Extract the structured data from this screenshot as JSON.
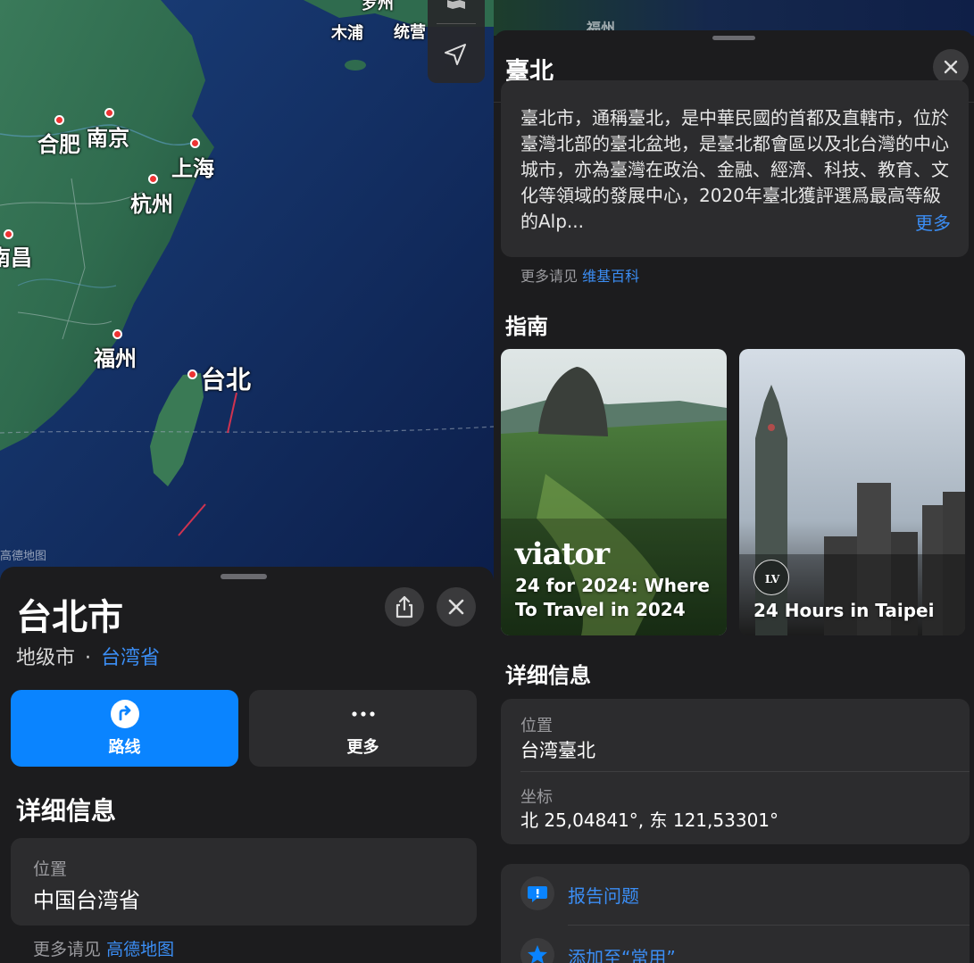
{
  "map": {
    "labels": {
      "hefei": "合肥",
      "nanjing": "南京",
      "shanghai": "上海",
      "hangzhou": "杭州",
      "nanchang": "南昌",
      "fuzhou": "福州",
      "taipei": "台北",
      "mupo": "木浦",
      "tongyeong": "统营",
      "top_partial": "罗州"
    },
    "attribution": "高德地图",
    "right_strip_label": "福州"
  },
  "left_sheet": {
    "title": "台北市",
    "subtitle_type": "地级市",
    "subtitle_sep": "·",
    "subtitle_link": "台湾省",
    "route_label": "路线",
    "more_label": "更多",
    "details_heading": "详细信息",
    "location_label": "位置",
    "location_value": "中国台湾省",
    "more_source_prefix": "更多请见",
    "more_source_link": "高德地图"
  },
  "right_sheet": {
    "title": "臺北",
    "description": "臺北市，通稱臺北，是中華民國的首都及直轄市，位於臺灣北部的臺北盆地，是臺北都會區以及北台灣的中心城市，亦為臺灣在政治、金融、經濟、科技、教育、文化等領域的發展中心，2020年臺北獲評選爲最高等級的Alp...",
    "description_more": "更多",
    "wiki_prefix": "更多请见",
    "wiki_link": "维基百科",
    "guides_heading": "指南",
    "guides": [
      {
        "brand": "viator",
        "caption_line1": "24 for 2024: Where",
        "caption_line2": "To Travel in 2024"
      },
      {
        "brand": "LOUIS VUITTON CITY GUIDE",
        "caption_line1": "24 Hours in Taipei"
      }
    ],
    "details_heading": "详细信息",
    "location_label": "位置",
    "location_value": "台湾臺北",
    "coords_label": "坐标",
    "coords_value": "北 25,04841°, 东 121,53301°",
    "report_label": "报告问题",
    "favorite_label": "添加至“常用”"
  },
  "colors": {
    "accent_blue": "#0a84ff",
    "link_blue": "#3b8ef5",
    "sheet_bg": "#1c1c1e",
    "card_bg": "#2c2c2e"
  },
  "icons": [
    "share-icon",
    "close-icon",
    "route-icon",
    "ellipsis-icon",
    "map-mode-icon",
    "location-arrow-icon",
    "report-bubble-icon",
    "star-icon"
  ]
}
